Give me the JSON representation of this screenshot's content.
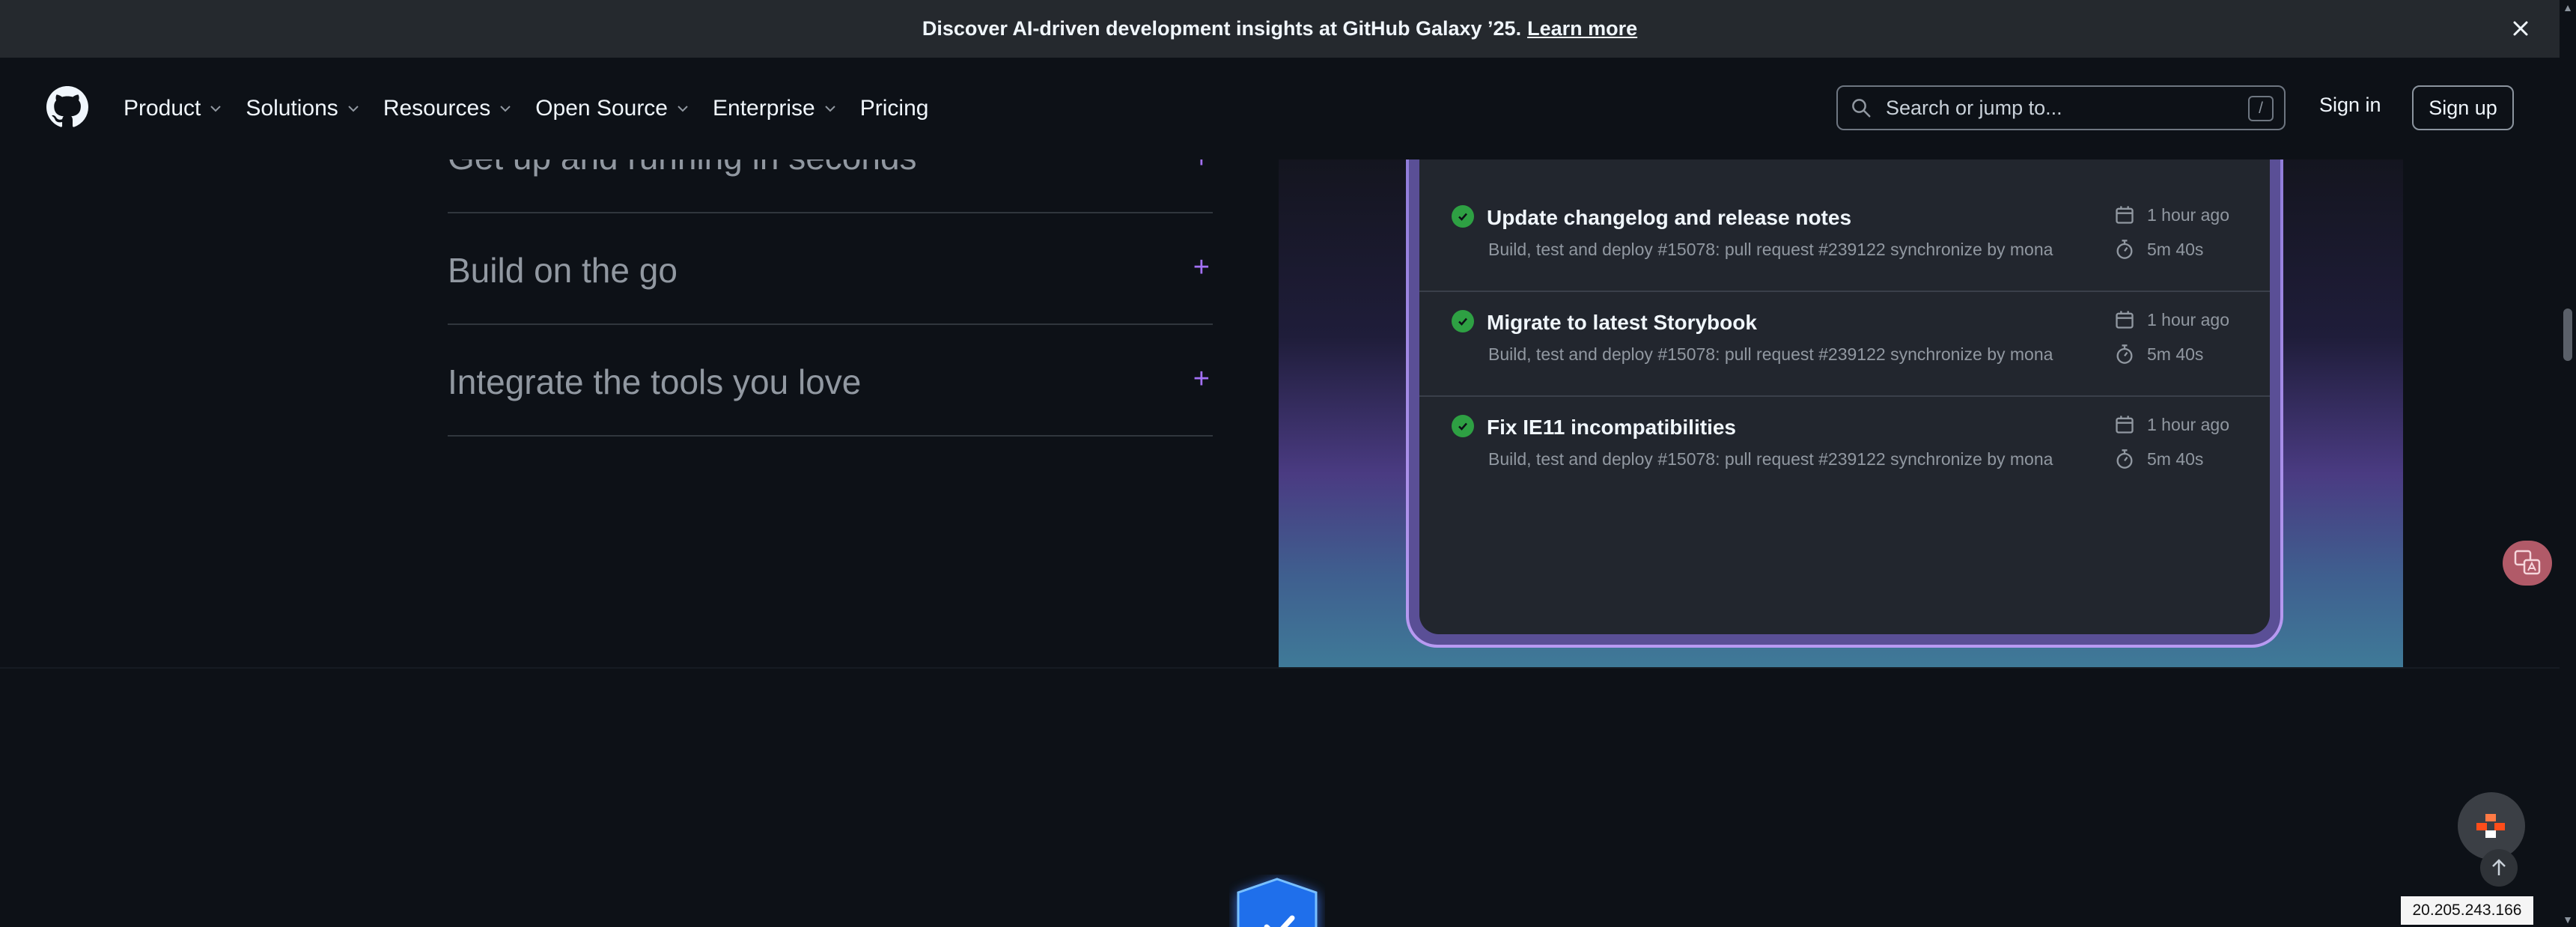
{
  "banner": {
    "text": "Discover AI-driven development insights at GitHub Galaxy ’25.",
    "link": "Learn more",
    "close_icon": "x-icon"
  },
  "header": {
    "logo_icon": "github-logo-icon",
    "nav": [
      {
        "label": "Product",
        "has_dropdown": true
      },
      {
        "label": "Solutions",
        "has_dropdown": true
      },
      {
        "label": "Resources",
        "has_dropdown": true
      },
      {
        "label": "Open Source",
        "has_dropdown": true
      },
      {
        "label": "Enterprise",
        "has_dropdown": true
      },
      {
        "label": "Pricing",
        "has_dropdown": false
      }
    ],
    "search": {
      "placeholder": "Search or jump to...",
      "shortcut": "/"
    },
    "sign_in": "Sign in",
    "sign_up": "Sign up"
  },
  "accordion": {
    "items": [
      {
        "title": "Get up and running in seconds",
        "toggle": "+"
      },
      {
        "title": "Build on the go",
        "toggle": "+"
      },
      {
        "title": "Integrate the tools you love",
        "toggle": "+"
      }
    ]
  },
  "workflow_runs": [
    {
      "title": "Update changelog and release notes",
      "subtitle": "Build, test and deploy #15078: pull request #239122 synchronize by mona",
      "time": "1 hour ago",
      "duration": "5m 40s",
      "status": "success"
    },
    {
      "title": "Migrate to latest Storybook",
      "subtitle": "Build, test and deploy #15078: pull request #239122 synchronize by mona",
      "time": "1 hour ago",
      "duration": "5m 40s",
      "status": "success"
    },
    {
      "title": "Fix IE11 incompatibilities",
      "subtitle": "Build, test and deploy #15078: pull request #239122 synchronize by mona",
      "time": "1 hour ago",
      "duration": "5m 40s",
      "status": "success"
    }
  ],
  "widgets": {
    "translate_label": "",
    "ip_address": "20.205.243.166"
  },
  "colors": {
    "accent_purple": "#a371f7",
    "success_green": "#2ea043",
    "background": "#0d1117"
  }
}
